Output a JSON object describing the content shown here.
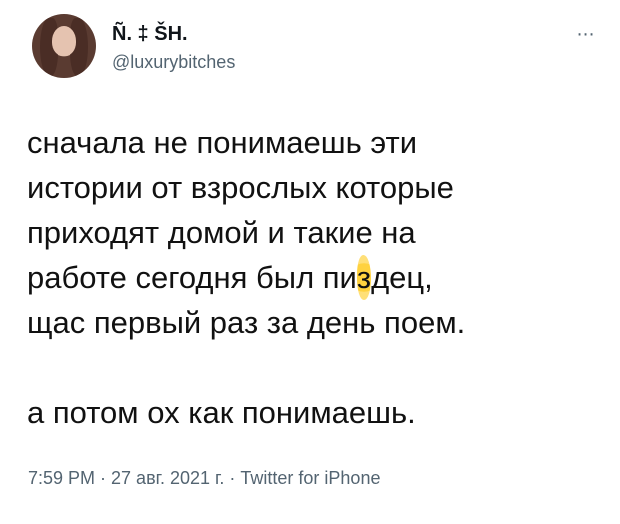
{
  "tweet": {
    "author": {
      "display_name": "Ñ. ‡ ŠH.",
      "handle": "@luxurybitches"
    },
    "more_icon": "more-horizontal-icon",
    "body_lines": [
      "сначала не понимаешь эти",
      "истории от взрослых которые",
      "приходят домой и такие на",
      "работе сегодня был пи",
      "щас первый раз за день поем.",
      "",
      "а потом ох как понимаешь."
    ],
    "censored_text": "з",
    "censored_suffix": "дец,",
    "meta": "7:59 PM · 27 авг. 2021 г. · Twitter for iPhone",
    "colors": {
      "text": "#0f1419",
      "secondary": "#536471",
      "highlight": "#ffd23f"
    }
  }
}
